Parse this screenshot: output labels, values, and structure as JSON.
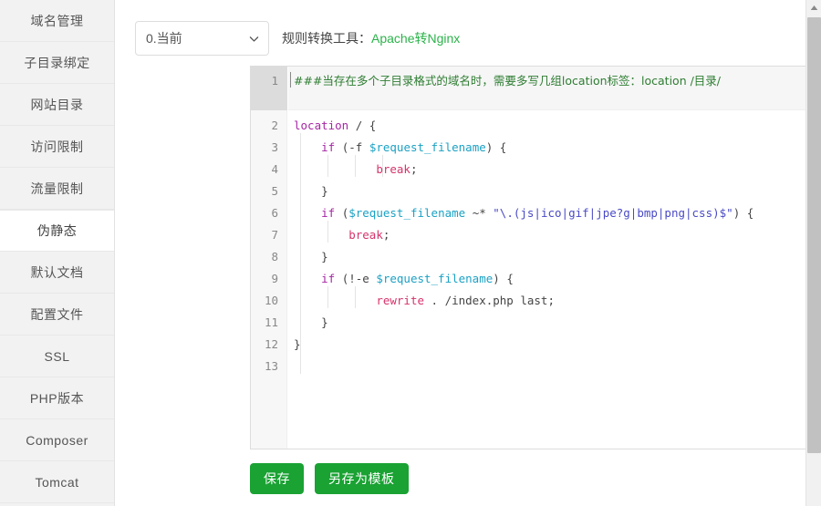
{
  "sidebar": {
    "items": [
      {
        "label": "域名管理",
        "active": false
      },
      {
        "label": "子目录绑定",
        "active": false
      },
      {
        "label": "网站目录",
        "active": false
      },
      {
        "label": "访问限制",
        "active": false
      },
      {
        "label": "流量限制",
        "active": false
      },
      {
        "label": "伪静态",
        "active": true
      },
      {
        "label": "默认文档",
        "active": false
      },
      {
        "label": "配置文件",
        "active": false
      },
      {
        "label": "SSL",
        "active": false
      },
      {
        "label": "PHP版本",
        "active": false
      },
      {
        "label": "Composer",
        "active": false
      },
      {
        "label": "Tomcat",
        "active": false
      }
    ]
  },
  "toolbar": {
    "select_value": "0.当前",
    "select_options": [
      "0.当前"
    ],
    "chevron_icon": "chevron-down-icon",
    "converter_label": "规则转换工具：",
    "converter_link": "Apache转Nginx",
    "link_color": "#2bb34a"
  },
  "editor": {
    "active_line": 1,
    "line_numbers": [
      "1",
      "2",
      "3",
      "4",
      "5",
      "6",
      "7",
      "8",
      "9",
      "10",
      "11",
      "12",
      "13"
    ],
    "lines": [
      {
        "n": "1",
        "text": "###当存在多个子目录格式的域名时，需要多写几组location标签：location /目录/"
      },
      {
        "n": "2",
        "text": "location / {"
      },
      {
        "n": "3",
        "text": "    if (-f $request_filename) {"
      },
      {
        "n": "4",
        "text": "            break;"
      },
      {
        "n": "5",
        "text": "    }"
      },
      {
        "n": "6",
        "text": "    if ($request_filename ~* \"\\.(js|ico|gif|jpe?g|bmp|png|css)$\") {"
      },
      {
        "n": "7",
        "text": "        break;"
      },
      {
        "n": "8",
        "text": "    }"
      },
      {
        "n": "9",
        "text": "    if (!-e $request_filename) {"
      },
      {
        "n": "10",
        "text": "            rewrite . /index.php last;"
      },
      {
        "n": "11",
        "text": "    }"
      },
      {
        "n": "12",
        "text": "}"
      },
      {
        "n": "13",
        "text": ""
      }
    ],
    "colors": {
      "comment": "#2e7d32",
      "keyword": "#a626a4",
      "variable": "#1ba1c4",
      "string": "#4a4ac6",
      "function": "#d6336c",
      "plain": "#444444"
    }
  },
  "buttons": {
    "save": "保存",
    "save_as_template": "另存为模板",
    "color": "#1aa233"
  },
  "scrollbar": {
    "up_arrow_icon": "triangle-up-icon"
  }
}
